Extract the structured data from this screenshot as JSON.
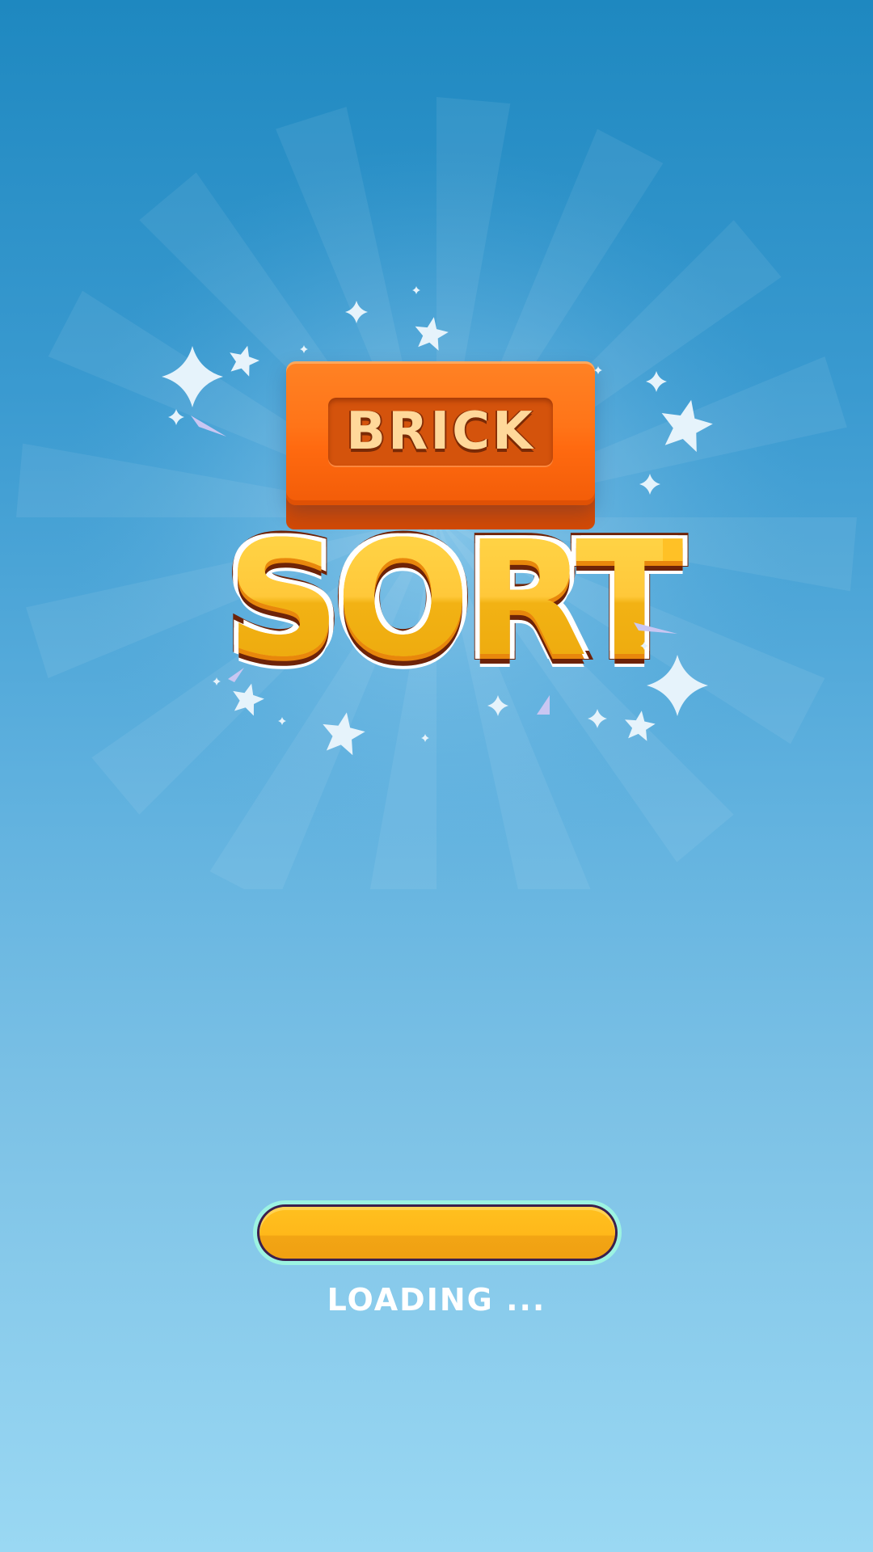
{
  "logo": {
    "brick_word": "BRICK",
    "sort_word": "SORT"
  },
  "loading": {
    "label": "LOADING ...",
    "progress_fraction": 1.0
  },
  "colors": {
    "background_top": "#1e88c0",
    "background_bottom": "#9ad8f3",
    "brick_orange": "#ff7418",
    "sort_yellow": "#ffc126",
    "sort_outline": "#6e2308",
    "loading_fill": "#ffb81a",
    "loading_border": "#9cf3e2"
  },
  "decorations": {
    "icon": "sparkle-star-icon"
  }
}
